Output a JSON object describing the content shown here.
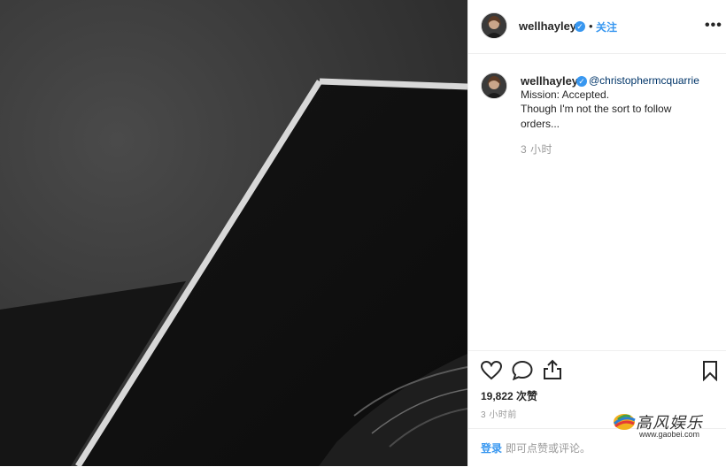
{
  "post": {
    "username": "wellhayley",
    "verified_icon": "verified-check-icon",
    "dot": "•",
    "follow_label": "关注",
    "more_label": "•••"
  },
  "caption": {
    "username": "wellhayley",
    "mention": "@christophermcquarrie",
    "line1": "Mission: Accepted.",
    "line2": "Though I'm not the sort to follow orders...",
    "time": "3 小时"
  },
  "actions": {
    "like_icon": "heart-icon",
    "comment_icon": "comment-icon",
    "share_icon": "share-icon",
    "save_icon": "bookmark-icon",
    "likes": "19,822 次赞",
    "posted": "3 小时前"
  },
  "footer": {
    "login_label": "登录",
    "prompt": "即可点赞或评论。"
  },
  "watermark": {
    "logo": "高风娱乐",
    "url": "www.gaobei.com"
  },
  "colors": {
    "accent": "#3897f0",
    "text": "#262626",
    "muted": "#999999",
    "mention": "#003569"
  }
}
